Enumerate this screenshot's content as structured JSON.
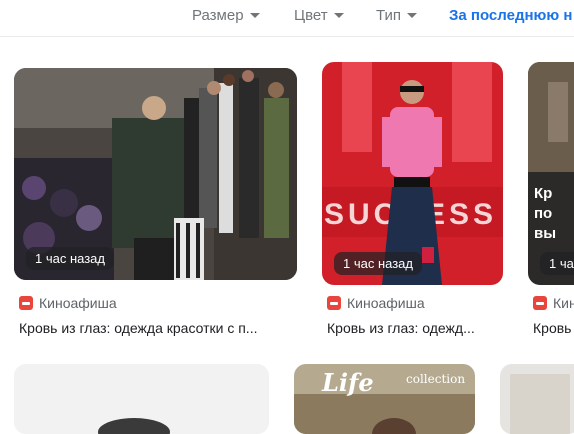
{
  "filters": [
    {
      "label": "Размер",
      "has_caret": true
    },
    {
      "label": "Цвет",
      "has_caret": true
    },
    {
      "label": "Тип",
      "has_caret": true
    },
    {
      "label": "За последнюю н",
      "has_caret": false,
      "active": true
    }
  ],
  "cards": [
    {
      "time": "1 час назад",
      "source": "Киноафиша",
      "title": "Кровь из глаз: одежда красотки с п..."
    },
    {
      "time": "1 час назад",
      "source": "Киноафиша",
      "title": "Кровь из глаз: одежд..."
    },
    {
      "time": "1 ча",
      "source": "Кино",
      "title": "Кровь",
      "overlay_text": [
        "Кр",
        "по",
        "вы"
      ]
    }
  ],
  "bottom_cards": [
    {
      "magazine_logo": "Life",
      "magazine_subtitle": "collection"
    }
  ],
  "icons": {
    "favicon": "kinoafisha-favicon-icon",
    "caret": "caret-down-icon"
  }
}
